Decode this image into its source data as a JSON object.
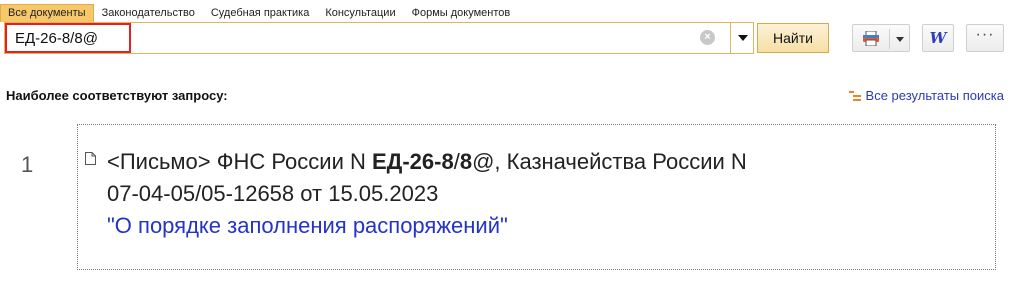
{
  "tabs": [
    {
      "label": "Все документы",
      "active": true
    },
    {
      "label": "Законодательство",
      "active": false
    },
    {
      "label": "Судебная практика",
      "active": false
    },
    {
      "label": "Консультации",
      "active": false
    },
    {
      "label": "Формы документов",
      "active": false
    }
  ],
  "search": {
    "value": "ЕД-26-8/8@",
    "find_label": "Найти"
  },
  "toolbar": {
    "print_icon": "printer-icon",
    "word_label": "W",
    "more_label": "···"
  },
  "results": {
    "heading": "Наиболее соответствуют запросу:",
    "all_results_label": "Все результаты поиска",
    "items": [
      {
        "number": "1",
        "prefix": "<Письмо> ФНС России N ",
        "match_1": "ЕД-26-8",
        "slash": "/",
        "match_2": "8",
        "after_match": "@, Казначейства России N",
        "line2": "07-04-05/05-12658 от 15.05.2023",
        "title": "\"О порядке заполнения распоряжений\""
      }
    ]
  },
  "colors": {
    "accent": "#f6c86a",
    "link": "#2433c8",
    "highlight_border": "#e52020"
  }
}
